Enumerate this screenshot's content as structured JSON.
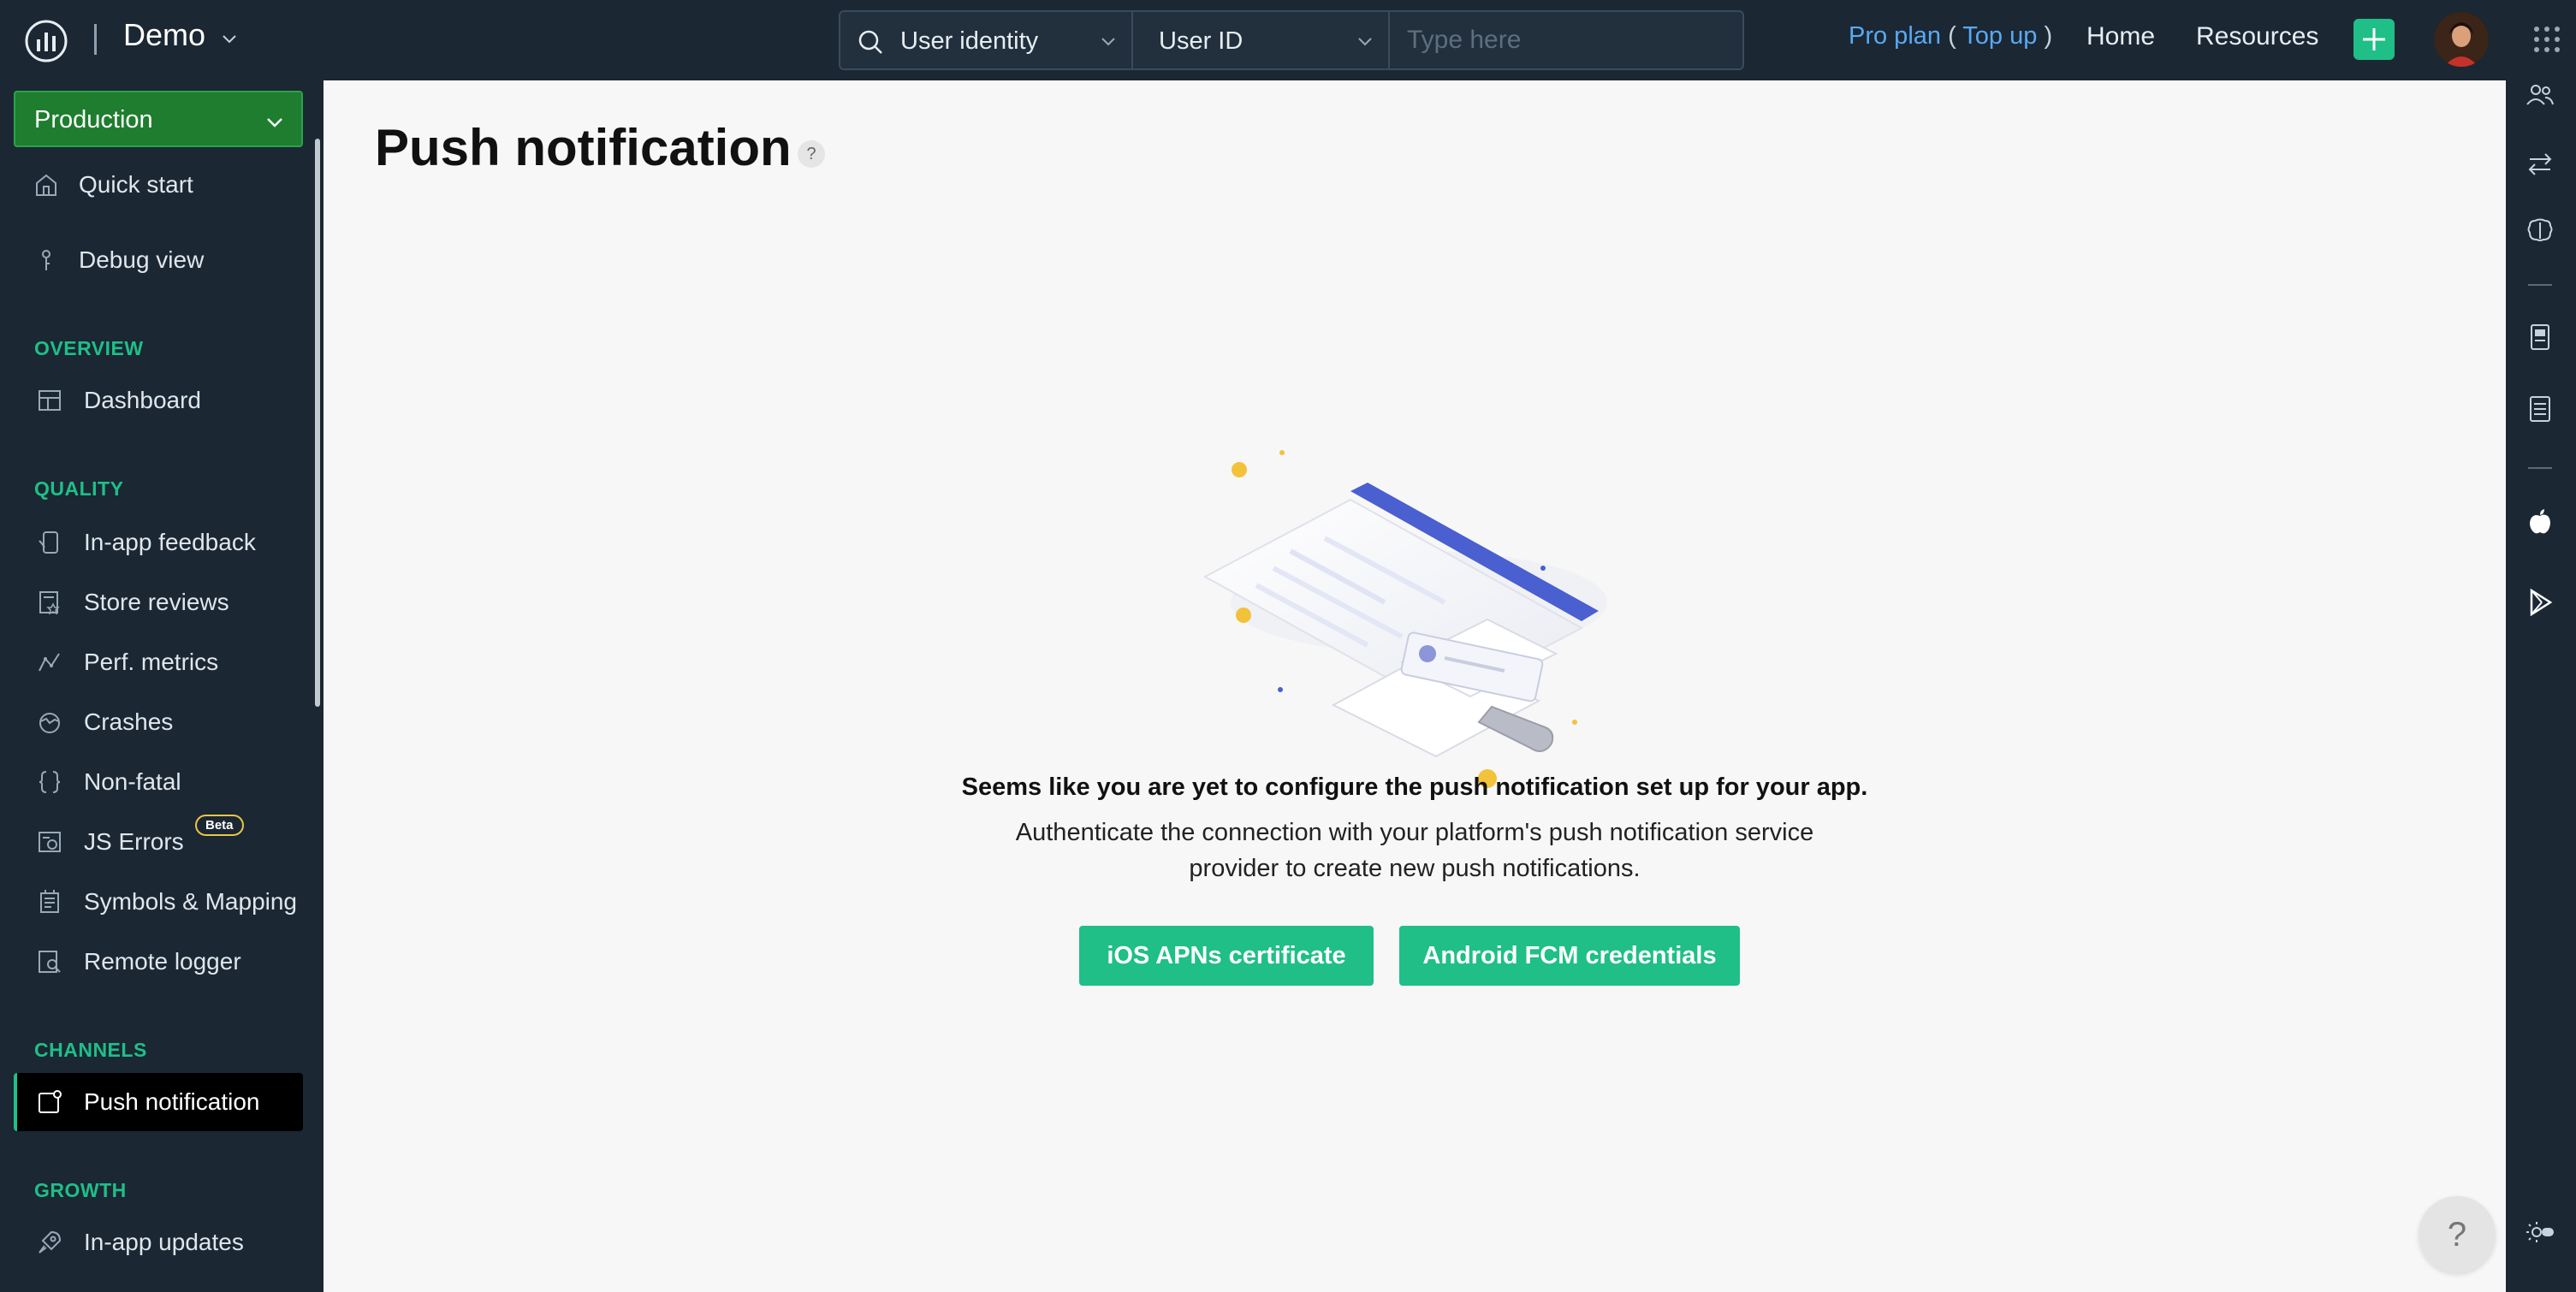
{
  "topbar": {
    "app_name": "Demo",
    "search": {
      "identity_label": "User identity",
      "field_label": "User ID",
      "placeholder": "Type here"
    },
    "plan": {
      "name": "Pro plan",
      "open": "(",
      "topup": "Top up",
      "close": ")"
    },
    "nav": {
      "home": "Home",
      "resources": "Resources"
    },
    "colors": {
      "accent": "#1fbf87",
      "link": "#5aa9f2"
    }
  },
  "sidebar": {
    "environment": "Production",
    "top_items": [
      {
        "label": "Quick start",
        "icon": "home-icon"
      },
      {
        "label": "Debug view",
        "icon": "debug-pin-icon"
      }
    ],
    "sections": {
      "overview": "OVERVIEW",
      "quality": "QUALITY",
      "channels": "CHANNELS",
      "growth": "GROWTH"
    },
    "items": {
      "dashboard": "Dashboard",
      "inapp_feedback": "In-app feedback",
      "store_reviews": "Store reviews",
      "perf_metrics": "Perf. metrics",
      "crashes": "Crashes",
      "non_fatal": "Non-fatal",
      "js_errors": "JS Errors",
      "js_errors_badge": "Beta",
      "symbols": "Symbols & Mapping",
      "remote_logger": "Remote logger",
      "push_notification": "Push notification",
      "inapp_updates": "In-app updates"
    }
  },
  "main": {
    "title": "Push notification",
    "help": "?",
    "empty_heading": "Seems like you are yet to configure the push notification set up for your app.",
    "empty_text": "Authenticate the connection with your platform's push notification service provider to create new push notifications.",
    "buttons": {
      "ios": "iOS APNs certificate",
      "android": "Android FCM credentials"
    },
    "help_fab": "?"
  }
}
